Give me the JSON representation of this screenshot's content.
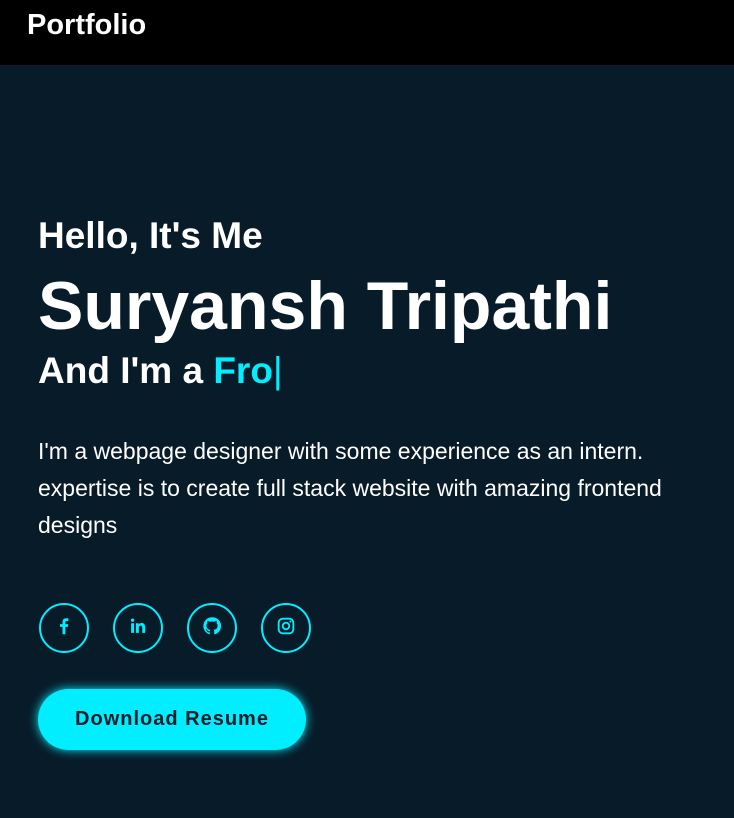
{
  "navbar": {
    "logo": "Portfolio"
  },
  "hero": {
    "greeting": "Hello, It's Me",
    "name": "Suryansh Tripathi",
    "role_prefix": "And I'm a ",
    "role_typed": "Fro",
    "cursor": "|",
    "bio": "I'm a webpage designer with some experience as an intern. expertise is to create full stack website with amazing frontend designs",
    "socials": [
      {
        "icon": "facebook-icon"
      },
      {
        "icon": "linkedin-icon"
      },
      {
        "icon": "github-icon"
      },
      {
        "icon": "instagram-icon"
      }
    ],
    "download_label": "Download Resume"
  },
  "colors": {
    "background": "#081b29",
    "navbar": "#000000",
    "accent": "#00eeff",
    "text": "#ffffff"
  }
}
